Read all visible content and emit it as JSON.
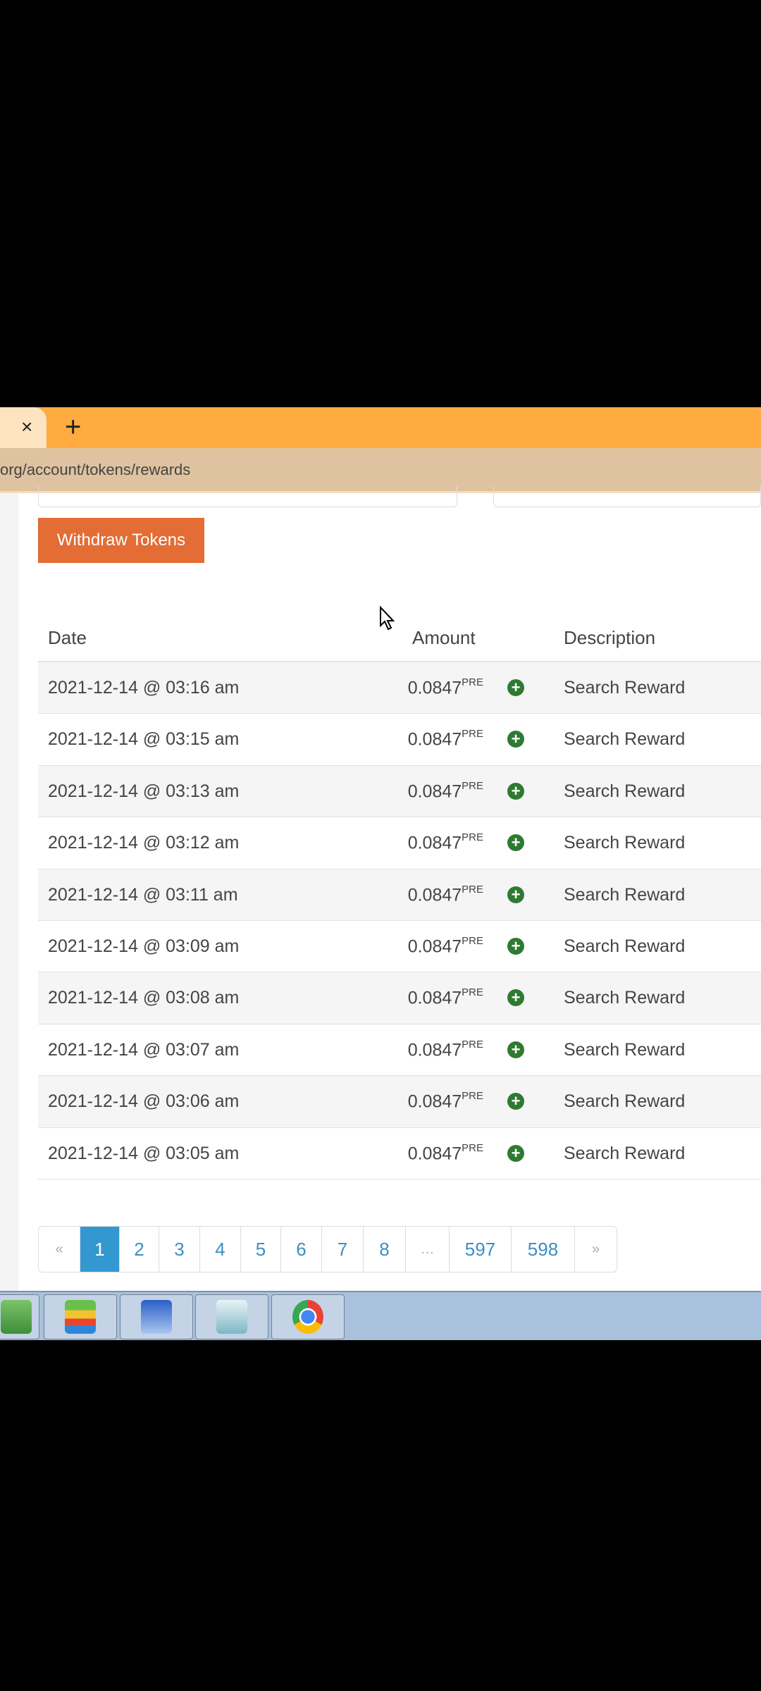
{
  "browser": {
    "tab_close": "×",
    "new_tab": "+",
    "url": "org/account/tokens/rewards"
  },
  "actions": {
    "withdraw": "Withdraw Tokens"
  },
  "table": {
    "headers": {
      "date": "Date",
      "amount": "Amount",
      "description": "Description"
    },
    "rows": [
      {
        "date": "2021-12-14 @ 03:16 am",
        "amount": "0.0847",
        "unit": "PRE",
        "description": "Search Reward"
      },
      {
        "date": "2021-12-14 @ 03:15 am",
        "amount": "0.0847",
        "unit": "PRE",
        "description": "Search Reward"
      },
      {
        "date": "2021-12-14 @ 03:13 am",
        "amount": "0.0847",
        "unit": "PRE",
        "description": "Search Reward"
      },
      {
        "date": "2021-12-14 @ 03:12 am",
        "amount": "0.0847",
        "unit": "PRE",
        "description": "Search Reward"
      },
      {
        "date": "2021-12-14 @ 03:11 am",
        "amount": "0.0847",
        "unit": "PRE",
        "description": "Search Reward"
      },
      {
        "date": "2021-12-14 @ 03:09 am",
        "amount": "0.0847",
        "unit": "PRE",
        "description": "Search Reward"
      },
      {
        "date": "2021-12-14 @ 03:08 am",
        "amount": "0.0847",
        "unit": "PRE",
        "description": "Search Reward"
      },
      {
        "date": "2021-12-14 @ 03:07 am",
        "amount": "0.0847",
        "unit": "PRE",
        "description": "Search Reward"
      },
      {
        "date": "2021-12-14 @ 03:06 am",
        "amount": "0.0847",
        "unit": "PRE",
        "description": "Search Reward"
      },
      {
        "date": "2021-12-14 @ 03:05 am",
        "amount": "0.0847",
        "unit": "PRE",
        "description": "Search Reward"
      }
    ]
  },
  "pagination": {
    "items": [
      "«",
      "1",
      "2",
      "3",
      "4",
      "5",
      "6",
      "7",
      "8",
      "…",
      "597",
      "598",
      "»"
    ],
    "current": "1"
  },
  "taskbar": {
    "apps": [
      "maps-app-icon",
      "bluestacks-icon",
      "on-screen-keyboard-icon",
      "notepad-icon",
      "chrome-icon"
    ]
  },
  "colors": {
    "tabbar": "#ffab40",
    "address_bar": "#dfc3a0",
    "withdraw_button": "#e46c35",
    "pager_active": "#3498d0",
    "plus_icon": "#2f7a32"
  }
}
